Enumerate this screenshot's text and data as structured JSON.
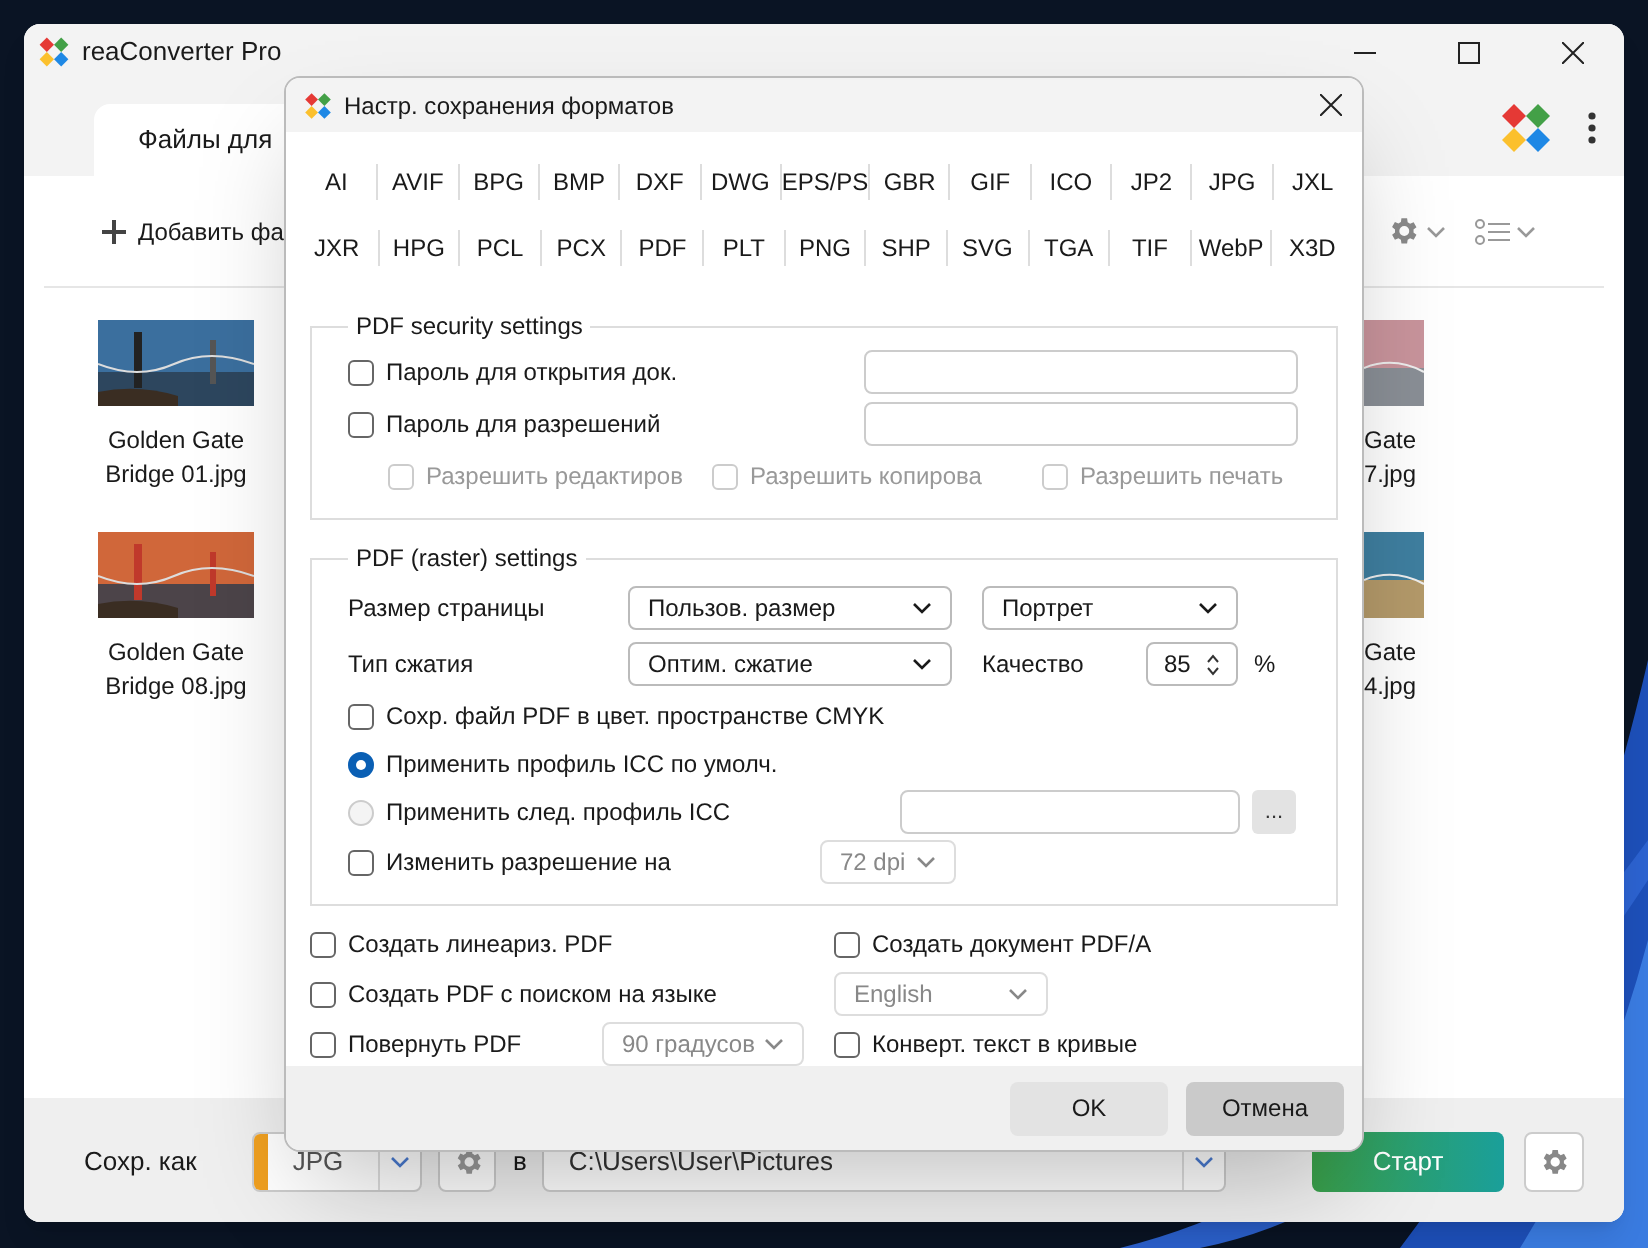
{
  "main_window": {
    "title": "reaConverter Pro",
    "tabs": [
      {
        "label": "Файлы для",
        "selected": true
      }
    ],
    "add_button": "Добавить фа",
    "files": [
      {
        "lines": [
          "Golden Gate",
          "Bridge 01.jpg"
        ]
      },
      {
        "lines": [
          "Golden Gate",
          "Bridge 08.jpg"
        ]
      }
    ],
    "files_right": [
      {
        "lines": [
          "Gate",
          "7.jpg"
        ]
      },
      {
        "lines": [
          "Gate",
          "4.jpg"
        ]
      }
    ],
    "save_bar": {
      "label": "Сохр. как",
      "format": "JPG",
      "to_label": "в",
      "path": "C:\\Users\\User\\Pictures",
      "start_button": "Старт"
    }
  },
  "dialog": {
    "title": "Настр. сохранения форматов",
    "format_rows": [
      [
        "AI",
        "AVIF",
        "BPG",
        "BMP",
        "DXF",
        "DWG",
        "EPS/PS",
        "GBR",
        "GIF",
        "ICO",
        "JP2",
        "JPG",
        "JXL"
      ],
      [
        "JXR",
        "HPG",
        "PCL",
        "PCX",
        "PDF",
        "PLT",
        "PNG",
        "SHP",
        "SVG",
        "TGA",
        "TIF",
        "WebP",
        "X3D"
      ]
    ],
    "security": {
      "legend": "PDF security settings",
      "passwords": [
        {
          "label": "Пароль для открытия док.",
          "checked": false
        },
        {
          "label": "Пароль для разрешений",
          "checked": false
        }
      ],
      "permissions": [
        {
          "label": "Разрешить редактиров",
          "checked": false,
          "disabled": true
        },
        {
          "label": "Разрешить копирова",
          "checked": false,
          "disabled": true
        },
        {
          "label": "Разрешить печать",
          "checked": false,
          "disabled": true
        }
      ]
    },
    "raster": {
      "legend": "PDF (raster) settings",
      "page_size": {
        "label": "Размер страницы",
        "size": "Пользов. размер",
        "orientation": "Портрет"
      },
      "compression": {
        "label": "Тип сжатия",
        "value": "Оптим. сжатие",
        "quality_label": "Качество",
        "quality": "85",
        "unit": "%"
      },
      "cmyk": {
        "label": "Сохр. файл PDF в цвет. пространстве CMYK",
        "checked": false
      },
      "icc": [
        {
          "label": "Применить профиль ICC по умолч.",
          "selected": true
        },
        {
          "label": "Применить след. профиль ICC",
          "selected": false
        }
      ],
      "browse_button": "...",
      "resolution": {
        "label": "Изменить разрешение на",
        "checked": false,
        "value": "72 dpi",
        "disabled": true
      }
    },
    "options": [
      {
        "label": "Создать линеариз. PDF",
        "checked": false
      },
      {
        "label": "Создать документ PDF/A",
        "checked": false
      },
      {
        "label": "Создать PDF с поиском на языке",
        "checked": false,
        "select": "English",
        "disabled": true
      },
      {
        "label": "Повернуть PDF",
        "checked": false,
        "select": "90 градусов",
        "disabled": true
      },
      {
        "label": "Конверт. текст в кривые",
        "checked": false
      }
    ],
    "buttons": [
      "OK",
      "Отмена"
    ]
  }
}
